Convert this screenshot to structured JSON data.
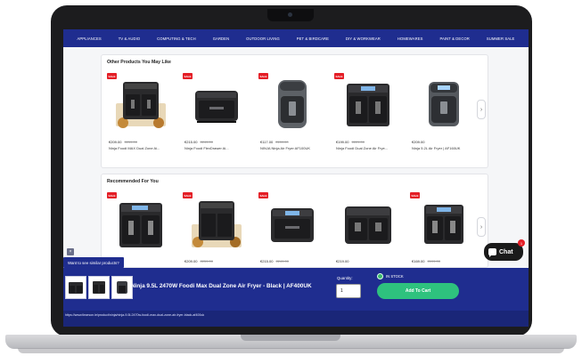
{
  "nav": {
    "items": [
      "APPLIANCES",
      "TV & AUDIO",
      "COMPUTING & TECH",
      "GARDEN",
      "OUTDOOR LIVING",
      "PET & BIRDCARE",
      "DIY & WORKWEAR",
      "HOMEWARES",
      "PAINT & DECOR",
      "SUMMER SALE"
    ]
  },
  "other_products": {
    "title": "Other Products You May Like",
    "next_icon": "chevron-right-icon",
    "items": [
      {
        "badge": "SALE",
        "price": "€209.00",
        "was": "€259.00",
        "name": "Ninja Foodi MAX Dual Zone Ai..."
      },
      {
        "badge": "SALE",
        "price": "€215.00",
        "was": "€249.00",
        "name": "Ninja Foodi FlexDrawer Ai..."
      },
      {
        "badge": "SALE",
        "price": "€117.00",
        "was": "€139.00",
        "name": "NINJA Ninja Air Fryer AF100UK"
      },
      {
        "badge": "SALE",
        "price": "€199.00",
        "was": "€229.00",
        "name": "Ninja Foodi Dual Zone Air Frye..."
      },
      {
        "badge": "",
        "price": "€209.00",
        "was": "",
        "name": "Ninja 5.2L Air Fryer | AF160UK"
      }
    ]
  },
  "recommended": {
    "title": "Recommended For You",
    "next_icon": "chevron-right-icon",
    "items": [
      {
        "badge": "SALE",
        "price": "",
        "was": ""
      },
      {
        "badge": "SALE",
        "price": "€209.00",
        "was": "€259.00"
      },
      {
        "badge": "SALE",
        "price": "€215.00",
        "was": "€249.00"
      },
      {
        "badge": "",
        "price": "€219.00",
        "was": ""
      },
      {
        "badge": "SALE",
        "price": "€169.00",
        "was": "€199.00"
      }
    ]
  },
  "similar_chip": {
    "label": "Want to see similar products?",
    "close": "×"
  },
  "chat": {
    "label": "Chat",
    "badge": "1"
  },
  "sticky": {
    "title": "Ninja 9.5L 2470W Foodi Max Dual Zone Air Fryer - Black | AF400UK",
    "quantity_label": "Quantity:",
    "quantity_value": "1",
    "stock": "IN STOCK",
    "add_to_cart": "Add To Cart"
  },
  "status_url": "https://www.tlearson.ie/product/ninja/ninja-9-5l-2470w-foodi-max-dual-zone-air-fryer-black-af400uk",
  "colors": {
    "nav": "#1f2d8f",
    "sale": "#e41e26",
    "cart": "#2ec27e",
    "chat": "#1a1a1a"
  }
}
